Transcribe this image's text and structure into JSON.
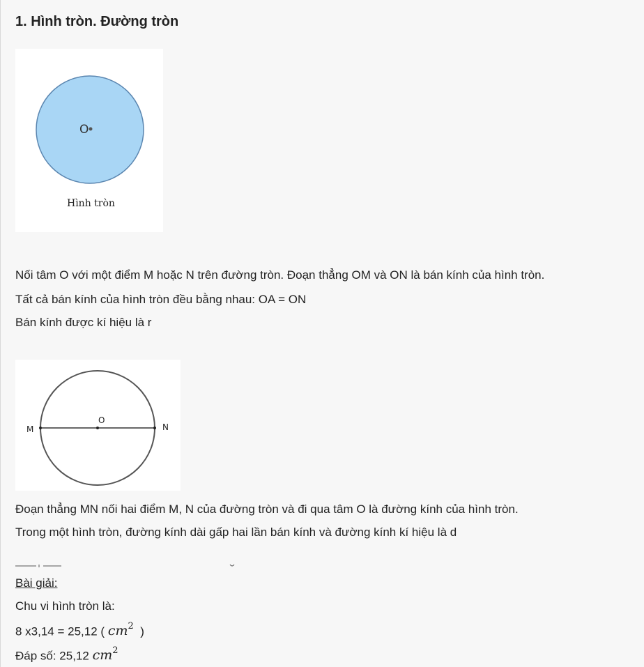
{
  "section": {
    "heading": "1. Hình tròn. Đường tròn"
  },
  "figure_circle": {
    "center_label": "O",
    "caption": "Hình tròn",
    "fill_color": "#a9d6f5",
    "stroke_color": "#5b86b0"
  },
  "paragraphs_radius": {
    "line1": "Nối tâm O với một điểm M hoặc N trên đường tròn. Đoạn thẳng OM và ON là bán kính của hình tròn.",
    "line2": "Tất cả bán kính của hình tròn đều bằng nhau: OA = ON",
    "line3": "Bán kính được kí hiệu là r"
  },
  "figure_diameter": {
    "center_label": "O",
    "left_label": "M",
    "right_label": "N"
  },
  "paragraphs_diameter": {
    "line1": "Đoạn thẳng MN nối hai điểm M, N của đường tròn và đi qua tâm O là đường kính của hình tròn.",
    "line2": "Trong một hình tròn, đường kính dài gấp hai lần bán kính và đường kính kí hiệu là d"
  },
  "solution": {
    "label": "Bài giải:",
    "line1": "Chu vi hình tròn là:",
    "calc_prefix": "8 x3,14 = 25,12 (",
    "calc_unit": "cm",
    "calc_exp": "2",
    "calc_suffix": ")",
    "answer_prefix": "Đáp số: 25,12",
    "answer_unit": "cm",
    "answer_exp": "2"
  }
}
